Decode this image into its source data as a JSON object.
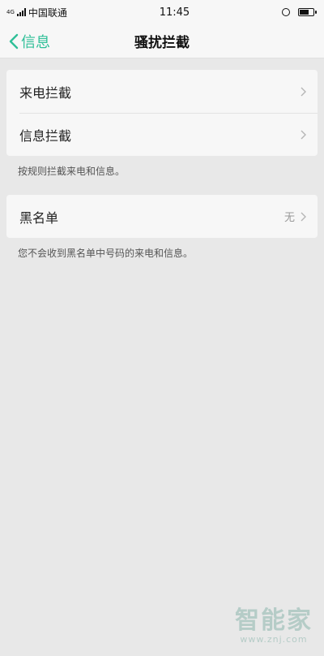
{
  "status_bar": {
    "carrier": "中国联通",
    "network": "4G",
    "time": "11:45",
    "battery_level": 0.7
  },
  "nav": {
    "back_label": "信息",
    "title": "骚扰拦截"
  },
  "group1": {
    "items": [
      {
        "label": "来电拦截"
      },
      {
        "label": "信息拦截"
      }
    ],
    "note": "按规则拦截来电和信息。"
  },
  "group2": {
    "items": [
      {
        "label": "黑名单",
        "value": "无"
      }
    ],
    "note": "您不会收到黑名单中号码的来电和信息。"
  },
  "watermark": {
    "logo": "智能家",
    "url": "www.znj.com"
  },
  "colors": {
    "accent": "#2fbf98",
    "background": "#e8e8e8",
    "card": "#f7f7f7"
  }
}
